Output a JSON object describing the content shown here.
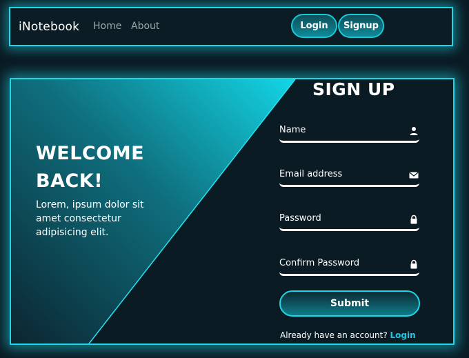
{
  "navbar": {
    "brand": "iNotebook",
    "links": [
      "Home",
      "About"
    ],
    "login_label": "Login",
    "signup_label": "Signup"
  },
  "hero": {
    "title_line1": "WELCOME",
    "title_line2": "BACK!",
    "description": "Lorem, ipsum dolor sit amet consectetur adipisicing elit."
  },
  "form": {
    "title": "SIGN UP",
    "fields": [
      {
        "label": "Name",
        "icon": "user-icon"
      },
      {
        "label": "Email address",
        "icon": "envelope-icon"
      },
      {
        "label": "Password",
        "icon": "lock-icon"
      },
      {
        "label": "Confirm Password",
        "icon": "lock-icon"
      }
    ],
    "submit_label": "Submit",
    "footer_text": "Already have an account?",
    "footer_link": "Login"
  },
  "colors": {
    "accent": "#1ed8e8",
    "background": "#0b1b24",
    "link": "#1ec8e6"
  }
}
